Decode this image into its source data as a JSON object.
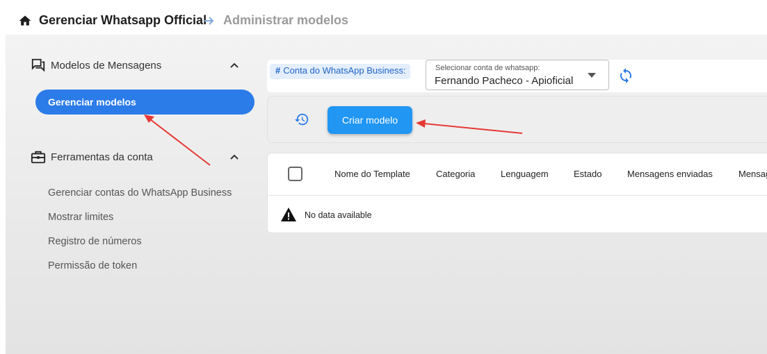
{
  "breadcrumb": {
    "root": "Gerenciar Whatsapp Official",
    "current": "Administrar modelos"
  },
  "sidebar": {
    "groups": [
      {
        "label": "Modelos de Mensagens",
        "icon": "chat-bubbles-icon",
        "expanded": true,
        "items": [
          {
            "label": "Gerenciar modelos",
            "active": true
          }
        ]
      },
      {
        "label": "Ferramentas da conta",
        "icon": "briefcase-icon",
        "expanded": true,
        "items": [
          {
            "label": "Gerenciar contas do WhatsApp Business",
            "active": false
          },
          {
            "label": "Mostrar limites",
            "active": false
          },
          {
            "label": "Registro de números",
            "active": false
          },
          {
            "label": "Permissão de token",
            "active": false
          }
        ]
      }
    ]
  },
  "account": {
    "chip_label": "Conta do WhatsApp Business:",
    "select_label": "Selecionar conta de whatsapp:",
    "select_value": "Fernando Pacheco - Apioficial"
  },
  "toolbar": {
    "create_label": "Criar modelo"
  },
  "table": {
    "columns": [
      "Nome do Template",
      "Categoria",
      "Lenguagem",
      "Estado",
      "Mensagens enviadas",
      "Mensag"
    ],
    "empty_text": "No data available"
  },
  "colors": {
    "accent": "#2b7be9",
    "button": "#2196f3",
    "annotation": "#e53935"
  }
}
